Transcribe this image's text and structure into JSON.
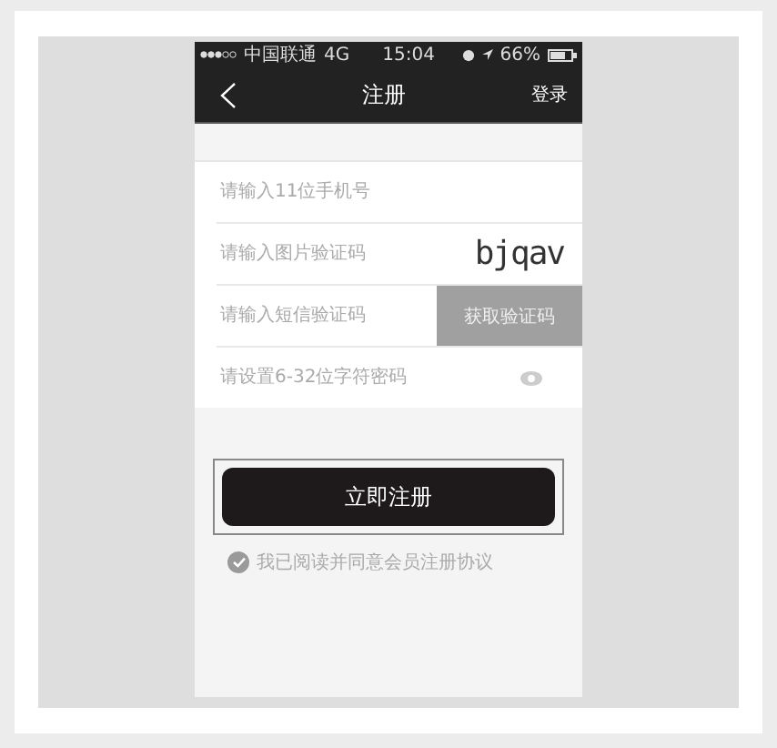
{
  "status_bar": {
    "carrier": "中国联通",
    "network": "4G",
    "time": "15:04",
    "battery": "66%"
  },
  "nav": {
    "title": "注册",
    "action": "登录"
  },
  "fields": [
    {
      "kind": "phone",
      "placeholder": "请输入11位手机号"
    },
    {
      "kind": "captcha",
      "placeholder": "请输入图片验证码",
      "captcha": "bjqav"
    },
    {
      "kind": "sms",
      "placeholder": "请输入短信验证码",
      "button": "获取验证码"
    },
    {
      "kind": "password",
      "placeholder": "请设置6-32位字符密码"
    }
  ],
  "submit": "立即注册",
  "agreement": {
    "checked": true,
    "text": "我已阅读并同意会员注册协议"
  }
}
